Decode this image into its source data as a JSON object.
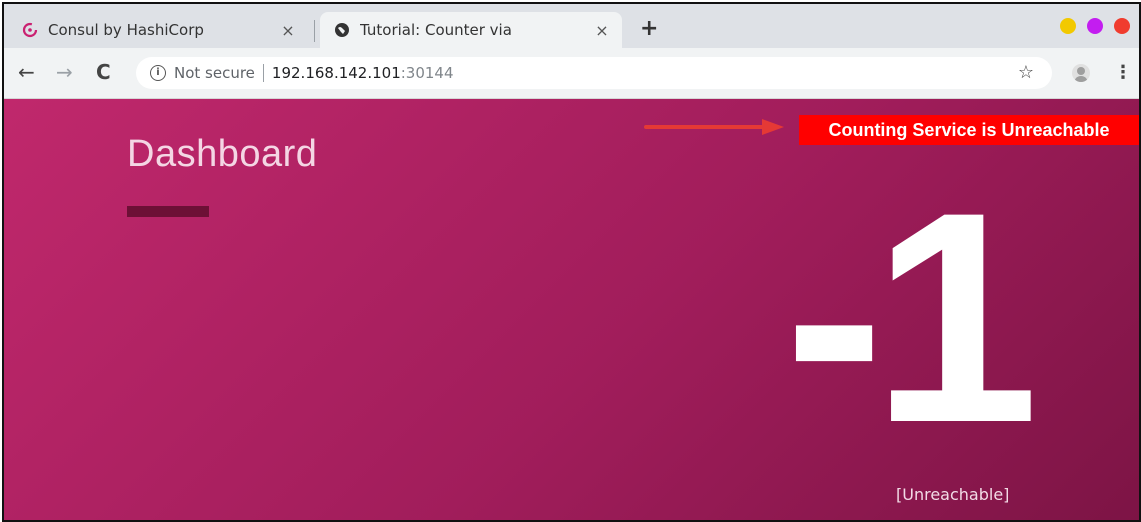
{
  "browser": {
    "tabs": [
      {
        "title": "Consul by HashiCorp",
        "close": "×",
        "icon": "consul-icon"
      },
      {
        "title": "Tutorial: Counter via",
        "close": "×",
        "icon": "globe-icon"
      }
    ],
    "new_tab": "+",
    "window_controls": {
      "minimize": "#f2c900",
      "maximize": "#c31df0",
      "close": "#f03c2e"
    },
    "address": {
      "security": "Not secure",
      "host": "192.168.142.101",
      "port": ":30144"
    },
    "nav": {
      "back": "←",
      "forward": "→",
      "reload": "C",
      "bookmark": "☆",
      "menu": "⋮"
    }
  },
  "page": {
    "title": "Dashboard",
    "count": "-1",
    "status": "[Unreachable]"
  },
  "annotation": {
    "label": "Counting Service is Unreachable",
    "color": "#ff0000"
  },
  "colors": {
    "background_start": "#c0286c",
    "background_end": "#7d1445",
    "accent_bar": "#6d1036"
  }
}
